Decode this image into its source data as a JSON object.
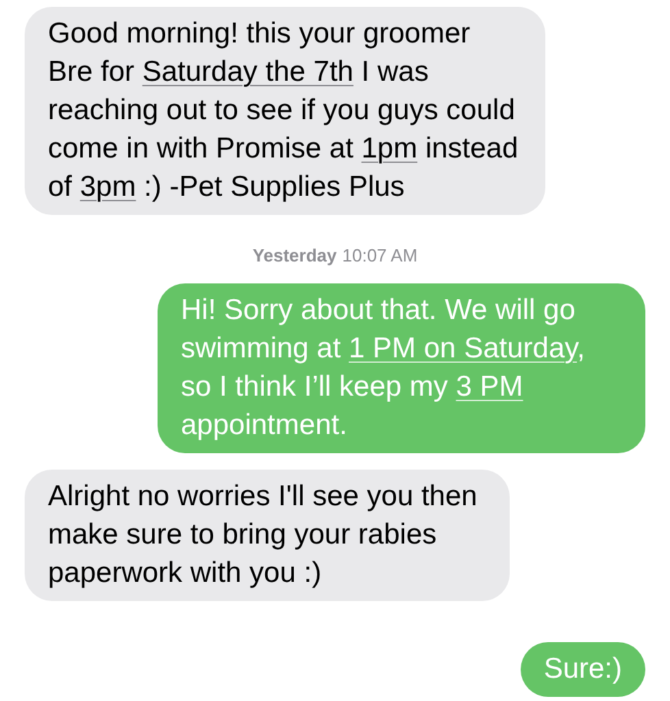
{
  "messages": [
    {
      "kind": "received",
      "segments": [
        {
          "text": "Good morning! this your groomer Bre for ",
          "link": false
        },
        {
          "text": "Saturday the 7th",
          "link": true
        },
        {
          "text": " I was reaching out to see if you guys could come in with Promise at ",
          "link": false
        },
        {
          "text": "1pm",
          "link": true
        },
        {
          "text": " instead of ",
          "link": false
        },
        {
          "text": "3pm",
          "link": true
        },
        {
          "text": " :) -Pet Supplies Plus",
          "link": false
        }
      ]
    },
    {
      "kind": "timestamp",
      "day": "Yesterday",
      "time": "10:07 AM"
    },
    {
      "kind": "sent",
      "segments": [
        {
          "text": "Hi! Sorry about that. We will go swimming at ",
          "link": false
        },
        {
          "text": "1 PM on Saturday",
          "link": true
        },
        {
          "text": ", so I think I’ll keep my ",
          "link": false
        },
        {
          "text": "3 PM",
          "link": true
        },
        {
          "text": " appointment.",
          "link": false
        }
      ]
    },
    {
      "kind": "received",
      "segments": [
        {
          "text": "Alright no worries I'll see you then make sure to bring your rabies paperwork with you :)",
          "link": false
        }
      ]
    },
    {
      "kind": "sent",
      "segments": [
        {
          "text": "Sure:)",
          "link": false
        }
      ]
    }
  ]
}
